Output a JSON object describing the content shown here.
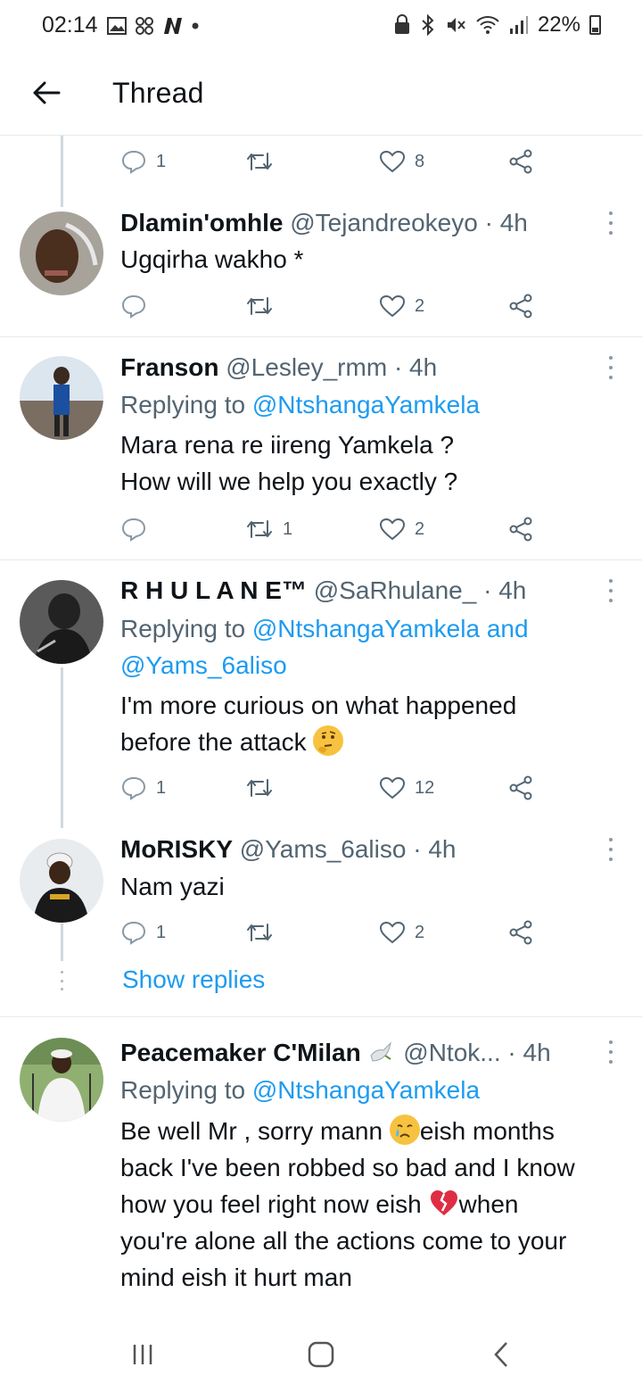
{
  "status_bar": {
    "time": "02:14",
    "battery": "22%",
    "left_icons": [
      "image-icon",
      "pinwheel-icon",
      "n-logo-icon",
      "dot-icon"
    ],
    "right_icons": [
      "lock-icon",
      "bluetooth-icon",
      "mute-icon",
      "wifi-icon",
      "signal-icon",
      "battery-icon"
    ]
  },
  "header": {
    "title": "Thread"
  },
  "top_actions": {
    "reply_count": "1",
    "retweet_count": "",
    "like_count": "8"
  },
  "tweets": [
    {
      "name": "Dlamin'omhle",
      "handle": "@Tejandreokeyo",
      "time": "4h",
      "body": [
        "Ugqirha wakho *"
      ],
      "reply_count": "",
      "retweet_count": "",
      "like_count": "2"
    },
    {
      "name": "Franson",
      "handle": "@Lesley_rmm",
      "time": "4h",
      "replying_label": "Replying to",
      "replying_to": "@NtshangaYamkela",
      "body": [
        "Mara rena re iireng Yamkela ?",
        "How will we help you exactly ?"
      ],
      "reply_count": "",
      "retweet_count": "1",
      "like_count": "2"
    },
    {
      "name": "R H U L A N E™",
      "handle": "@SaRhulane_",
      "time": "4h",
      "replying_label": "Replying to",
      "replying_to": "@NtshangaYamkela",
      "replying_and": "and",
      "replying_to_2": "@Yams_6aliso",
      "body": [
        "I'm more curious on what happened",
        "before the attack"
      ],
      "reply_count": "1",
      "retweet_count": "",
      "like_count": "12"
    },
    {
      "name": "MoRISKY",
      "handle": "@Yams_6aliso",
      "time": "4h",
      "body": [
        "Nam yazi"
      ],
      "reply_count": "1",
      "retweet_count": "",
      "like_count": "2"
    },
    {
      "name": "Peacemaker C'Milan",
      "handle": "@Ntok...",
      "time": "4h",
      "replying_label": "Replying to",
      "replying_to": "@NtshangaYamkela",
      "body_l1a": "Be well Mr , sorry mann",
      "body_l1b": "eish months",
      "body_l2": "back I've been robbed so bad and I know",
      "body_l3a": "how you feel right now eish",
      "body_l3b": "when",
      "body_l4": "you're alone all the actions come to your",
      "body_l5": "mind eish it hurt man"
    }
  ],
  "show_replies": "Show replies",
  "separator": "·",
  "colors": {
    "accent": "#1d9bf0",
    "muted": "#536471",
    "line": "#cfd9de"
  }
}
